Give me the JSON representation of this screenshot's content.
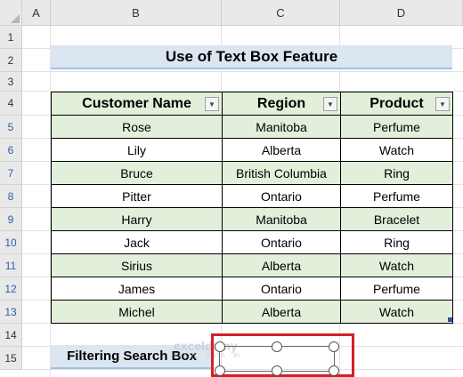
{
  "columns": [
    "A",
    "B",
    "C",
    "D"
  ],
  "rows": [
    "1",
    "2",
    "3",
    "4",
    "5",
    "6",
    "7",
    "8",
    "9",
    "10",
    "11",
    "12",
    "13",
    "14",
    "15"
  ],
  "title": "Use of Text Box Feature",
  "table": {
    "headers": [
      "Customer Name",
      "Region",
      "Product"
    ],
    "rows": [
      [
        "Rose",
        "Manitoba",
        "Perfume"
      ],
      [
        "Lily",
        "Alberta",
        "Watch"
      ],
      [
        "Bruce",
        "British Columbia",
        "Ring"
      ],
      [
        "Pitter",
        "Ontario",
        "Perfume"
      ],
      [
        "Harry",
        "Manitoba",
        "Bracelet"
      ],
      [
        "Jack",
        "Ontario",
        "Ring"
      ],
      [
        "Sirius",
        "Alberta",
        "Watch"
      ],
      [
        "James",
        "Ontario",
        "Perfume"
      ],
      [
        "Michel",
        "Alberta",
        "Watch"
      ]
    ]
  },
  "search_label": "Filtering Search Box",
  "watermark": {
    "name": "exceldemy",
    "tag": "EXCEL · DATA · BI"
  },
  "colors": {
    "header_fill": "#e2efda",
    "title_fill": "#dce6f1",
    "highlight": "#d61f26"
  }
}
